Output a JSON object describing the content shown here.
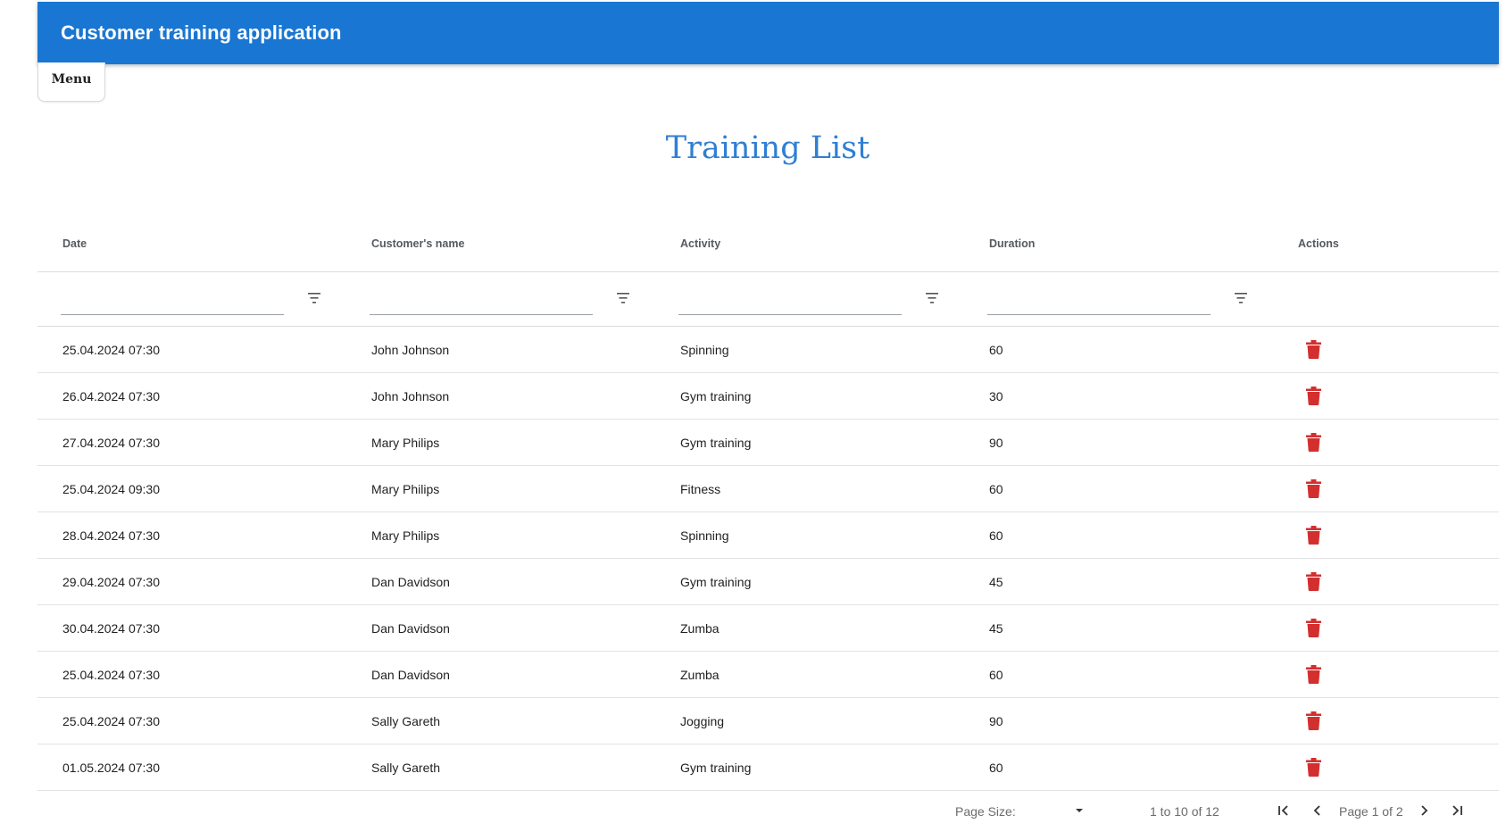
{
  "appbar": {
    "title": "Customer training application"
  },
  "menu": {
    "label": "Menu"
  },
  "page": {
    "title": "Training List"
  },
  "grid": {
    "columns": [
      "Date",
      "Customer's name",
      "Activity",
      "Duration",
      "Actions"
    ],
    "rows": [
      {
        "date": "25.04.2024 07:30",
        "customer": "John Johnson",
        "activity": "Spinning",
        "duration": "60"
      },
      {
        "date": "26.04.2024 07:30",
        "customer": "John Johnson",
        "activity": "Gym training",
        "duration": "30"
      },
      {
        "date": "27.04.2024 07:30",
        "customer": "Mary Philips",
        "activity": "Gym training",
        "duration": "90"
      },
      {
        "date": "25.04.2024 09:30",
        "customer": "Mary Philips",
        "activity": "Fitness",
        "duration": "60"
      },
      {
        "date": "28.04.2024 07:30",
        "customer": "Mary Philips",
        "activity": "Spinning",
        "duration": "60"
      },
      {
        "date": "29.04.2024 07:30",
        "customer": "Dan Davidson",
        "activity": "Gym training",
        "duration": "45"
      },
      {
        "date": "30.04.2024 07:30",
        "customer": "Dan Davidson",
        "activity": "Zumba",
        "duration": "45"
      },
      {
        "date": "25.04.2024 07:30",
        "customer": "Dan Davidson",
        "activity": "Zumba",
        "duration": "60"
      },
      {
        "date": "25.04.2024 07:30",
        "customer": "Sally Gareth",
        "activity": "Jogging",
        "duration": "90"
      },
      {
        "date": "01.05.2024 07:30",
        "customer": "Sally Gareth",
        "activity": "Gym training",
        "duration": "60"
      }
    ]
  },
  "pager": {
    "page_size_label": "Page Size:",
    "range_text": "1 to 10 of 12",
    "page_text": "Page 1 of 2"
  },
  "colors": {
    "appbar": "#1976d2",
    "title": "#2f7fd4",
    "delete": "#d32f2f"
  },
  "icons": {
    "filter": "filter-icon",
    "delete": "trash-icon",
    "first": "first-page-icon",
    "prev": "chevron-left-icon",
    "next": "chevron-right-icon",
    "last": "last-page-icon",
    "dropdown": "caret-down-icon"
  }
}
